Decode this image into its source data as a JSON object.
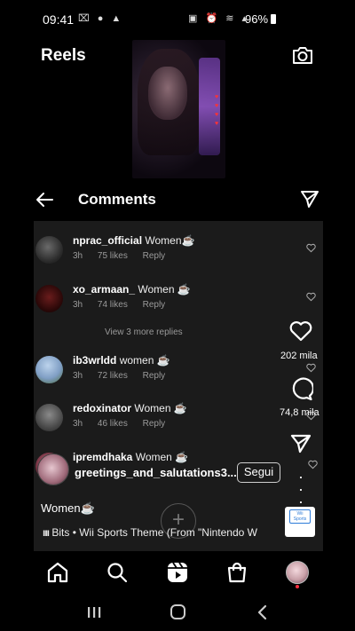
{
  "status_bar": {
    "time": "09:41",
    "left_icons": "⌧ ● ▲",
    "right_icons": "▣ ⏰ ≋ ▴",
    "battery": "96%"
  },
  "reels": {
    "title": "Reels"
  },
  "comments_header": {
    "title": "Comments"
  },
  "comments": [
    {
      "username": "nprac_official",
      "text": "Women☕",
      "age": "3h",
      "likes": "75 likes",
      "reply": "Reply",
      "avatar_color": "#3b3b3b"
    },
    {
      "username": "xo_armaan_",
      "text": "Women ☕",
      "age": "3h",
      "likes": "74 likes",
      "reply": "Reply",
      "avatar_color": "#3a1414"
    },
    {
      "username": "ib3wrldd",
      "text": "women ☕",
      "age": "3h",
      "likes": "72 likes",
      "reply": "Reply",
      "avatar_color": "#7f9ec4"
    },
    {
      "username": "redoxinator",
      "text": "Women ☕",
      "age": "3h",
      "likes": "46 likes",
      "reply": "Reply",
      "avatar_color": "#5a5a5a"
    },
    {
      "username": "ipremdhaka",
      "text": "Women ☕",
      "age": "",
      "likes": "",
      "reply": "",
      "avatar_color": "#6b2a3a"
    }
  ],
  "view_more_replies": "View 3 more replies",
  "actions": {
    "likes": "202 mila",
    "comments": "74,8 mila"
  },
  "post": {
    "author": "greetings_and_salutations3...",
    "follow_label": "Segui",
    "caption": "Women☕",
    "audio": "Bits • Wii Sports Theme (From \"Nintendo W",
    "album_label": "Wii Sports"
  },
  "icons": {
    "camera": "camera-icon",
    "back": "arrow-left-icon",
    "send": "paper-plane-icon",
    "heart": "heart-icon",
    "comment": "speech-bubble-icon",
    "home": "home-icon",
    "search": "search-icon",
    "reels": "reels-icon",
    "shop": "shopping-bag-icon"
  }
}
